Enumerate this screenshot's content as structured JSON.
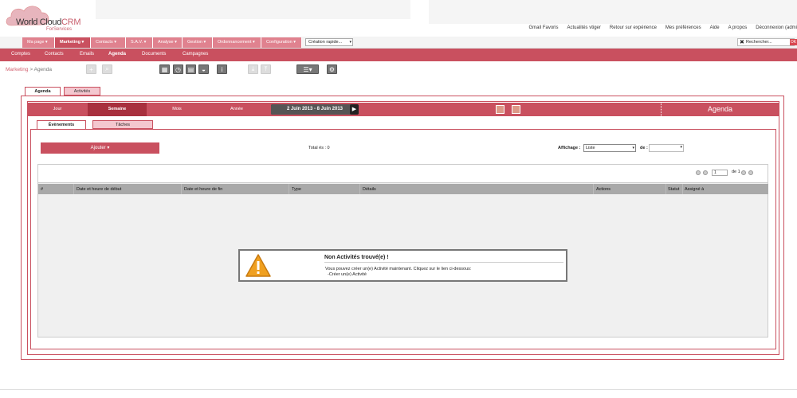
{
  "logo": {
    "brand_main": "World Cloud",
    "brand_crm": "CRM",
    "tagline": "ForServices"
  },
  "toplinks": [
    "Gmail Favoris",
    "Actualités vtiger",
    "Retour sur expérience",
    "Mes préférences",
    "Aide",
    "A propos",
    "Déconnexion (admi"
  ],
  "mainnav": {
    "tabs": [
      "Ma page ▾",
      "Marketing ▾",
      "Contacts ▾",
      "S.A.V. ▾",
      "Analyse ▾",
      "Gestion ▾",
      "Ordonnancement ▾",
      "Configuration ▾"
    ],
    "active_index": 1,
    "quick_create": "Création rapide...",
    "search_label": "Rechercher...",
    "ok": "OK"
  },
  "subnav": {
    "items": [
      "Comptes",
      "Contacts",
      "Emails",
      "Agenda",
      "Documents",
      "Campagnes"
    ],
    "active": "Agenda"
  },
  "breadcrumb": {
    "module": "Marketing",
    "sep": " > ",
    "page": "Agenda"
  },
  "outer_tabs": {
    "active": "Agenda",
    "other": "Activités"
  },
  "calendar": {
    "views": [
      "Jour",
      "Semaine",
      "Mois",
      "Année"
    ],
    "active_view": "Semaine",
    "date_range": "2 Juin 2013 - 8 Juin 2013",
    "title": "Agenda"
  },
  "inner_tabs": {
    "active": "Évènements",
    "other": "Tâches"
  },
  "list": {
    "add_button": "Ajouter ▾",
    "total": "Total ës : 0",
    "display_label": "Affichage :",
    "display_value": "Liste",
    "de_label": "de :",
    "page_value": "1",
    "page_of": "de 1",
    "columns": [
      "#",
      "Date et heure de début",
      "Date et heure de fin",
      "Type",
      "Détails",
      "Actions",
      "Statut",
      "Assigné à"
    ]
  },
  "empty": {
    "title": "Non Activités trouvé(e) !",
    "text": "Vous pouvez créer un(e) Activité maintenant. Cliquez sur le lien ci-dessous:",
    "link": "-Créer un(e) Activité"
  },
  "colors": {
    "accent": "#c9505f",
    "accent_light": "#e0828f",
    "tab_idle": "#f4c7cf"
  }
}
